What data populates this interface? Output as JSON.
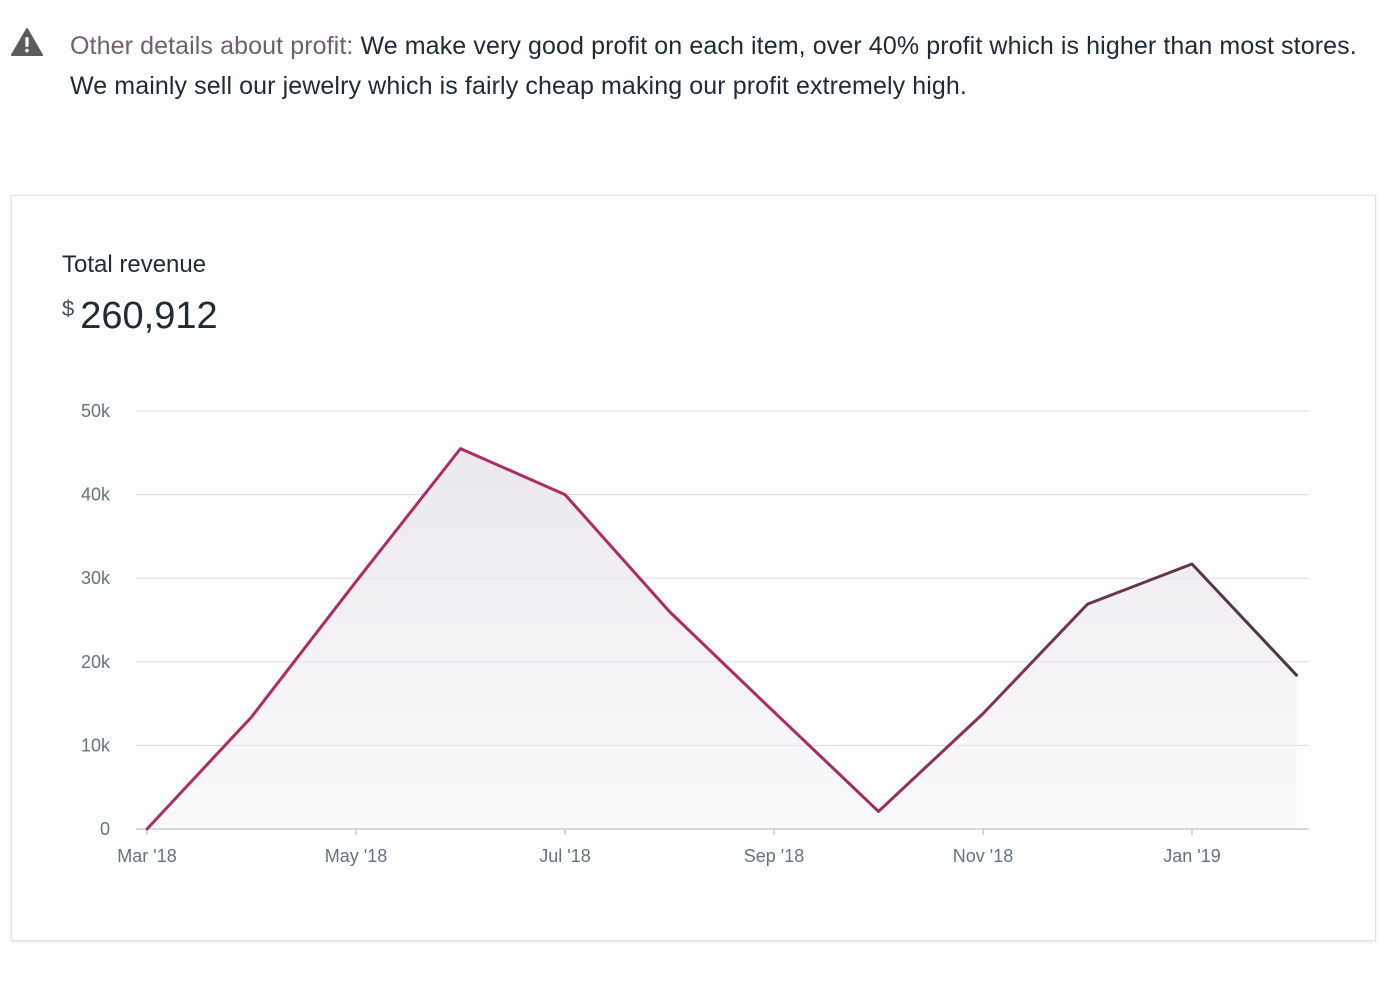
{
  "notice": {
    "icon": "warning-icon",
    "label": "Other details about profit:",
    "text": " We make very good profit on each item, over 40% profit which is higher than most stores. We mainly sell our jewelry which is fairly cheap making our profit extremely high."
  },
  "card": {
    "title": "Total revenue",
    "currency": "$",
    "amount": "260,912"
  },
  "colors": {
    "line_start": "#b02a64",
    "line_end": "#43393f",
    "area_fill": "#ece9ee",
    "grid": "#dcdcdc",
    "tick_text": "#637381"
  },
  "chart_data": {
    "type": "area",
    "title": "Total revenue",
    "xlabel": "",
    "ylabel": "",
    "x": [
      "2018-03-01",
      "2018-04-01",
      "2018-05-01",
      "2018-06-01",
      "2018-07-01",
      "2018-08-01",
      "2018-09-01",
      "2018-10-01",
      "2018-11-01",
      "2018-12-01",
      "2019-01-01",
      "2019-02-01"
    ],
    "values": [
      0,
      13400,
      29600,
      45500,
      40000,
      26000,
      14000,
      2100,
      13800,
      26900,
      31700,
      18400
    ],
    "x_tick_labels": [
      "Mar '18",
      "May '18",
      "Jul '18",
      "Sep '18",
      "Nov '18",
      "Jan '19"
    ],
    "x_tick_indices": [
      0,
      2,
      4,
      6,
      8,
      10
    ],
    "y_ticks": [
      0,
      10000,
      20000,
      30000,
      40000,
      50000
    ],
    "y_tick_labels": [
      "0",
      "10k",
      "20k",
      "30k",
      "40k",
      "50k"
    ],
    "ylim": [
      0,
      50000
    ],
    "grid": true,
    "legend": "none"
  }
}
